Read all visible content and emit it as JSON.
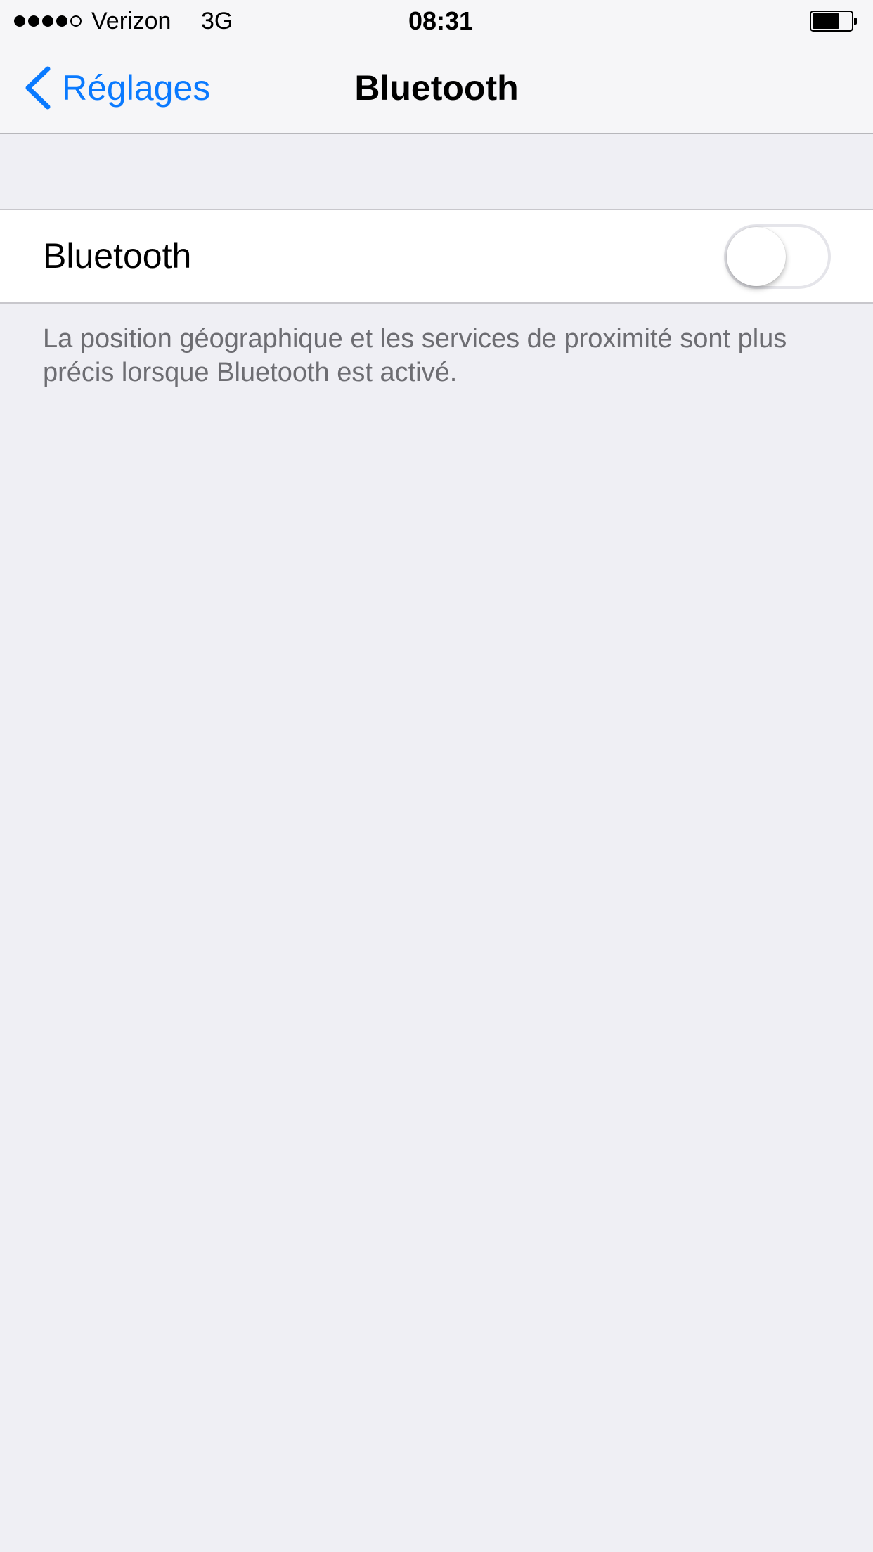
{
  "status_bar": {
    "signal_bars_filled": 4,
    "signal_bars_total": 5,
    "carrier": "Verizon",
    "network": "3G",
    "time": "08:31",
    "battery_level": 0.7
  },
  "nav": {
    "back_label": "Réglages",
    "title": "Bluetooth",
    "accent_color": "#0a7aff"
  },
  "bluetooth_cell": {
    "label": "Bluetooth",
    "toggle_on": false
  },
  "footer": {
    "note": "La position géographique et les services de proximité sont plus précis lorsque Bluetooth est activé."
  }
}
